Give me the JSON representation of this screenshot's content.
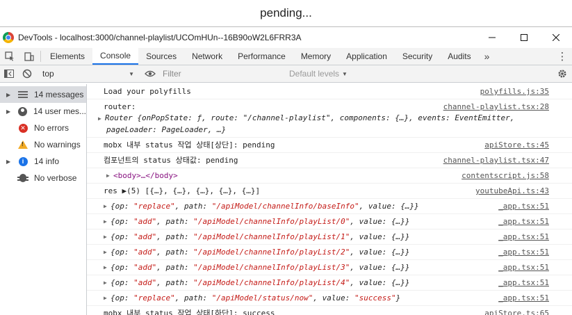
{
  "page": {
    "status_text": "pending..."
  },
  "window": {
    "title": "DevTools - localhost:3000/channel-playlist/UCOmHUn--16B90oW2L6FRR3A",
    "controls": [
      "minimize",
      "maximize",
      "close"
    ]
  },
  "tabs": [
    "Elements",
    "Console",
    "Sources",
    "Network",
    "Performance",
    "Memory",
    "Application",
    "Security",
    "Audits"
  ],
  "active_tab": "Console",
  "toolbar": {
    "context": "top",
    "filter_placeholder": "Filter",
    "levels_label": "Default levels"
  },
  "sidebar": {
    "items": [
      {
        "label": "14 messages",
        "icon": "list-icon",
        "selected": true
      },
      {
        "label": "14 user mes...",
        "icon": "user-icon"
      },
      {
        "label": "No errors",
        "icon": "error-icon"
      },
      {
        "label": "No warnings",
        "icon": "warning-icon"
      },
      {
        "label": "14 info",
        "icon": "info-icon"
      },
      {
        "label": "No verbose",
        "icon": "bug-icon"
      }
    ]
  },
  "messages": [
    {
      "text": "Load your polyfills",
      "source": "polyfills.js:35"
    },
    {
      "text": "router:",
      "source": "channel-playlist.tsx:28",
      "detail": "Router {onPopState: ƒ, route: \"/channel-playlist\", components: {…}, events: EventEmitter, pageLoader: PageLoader, …}"
    },
    {
      "text": "mobx 내부 status 작업 상태[상단]: pending",
      "source": "apiStore.ts:45"
    },
    {
      "text": "컴포넌트의 status 상태값: pending",
      "source": "channel-playlist.tsx:47"
    },
    {
      "text": "<body>…</body>",
      "source": "contentscript.js:58"
    },
    {
      "text": "res ▶(5) [{…}, {…}, {…}, {…}, {…}]",
      "source": "youtubeApi.ts:43"
    },
    {
      "text": "{op: \"replace\", path: \"/apiModel/channelInfo/baseInfo\", value: {…}}",
      "source": "_app.tsx:51"
    },
    {
      "text": "{op: \"add\", path: \"/apiModel/channelInfo/playList/0\", value: {…}}",
      "source": "_app.tsx:51"
    },
    {
      "text": "{op: \"add\", path: \"/apiModel/channelInfo/playList/1\", value: {…}}",
      "source": "_app.tsx:51"
    },
    {
      "text": "{op: \"add\", path: \"/apiModel/channelInfo/playList/2\", value: {…}}",
      "source": "_app.tsx:51"
    },
    {
      "text": "{op: \"add\", path: \"/apiModel/channelInfo/playList/3\", value: {…}}",
      "source": "_app.tsx:51"
    },
    {
      "text": "{op: \"add\", path: \"/apiModel/channelInfo/playList/4\", value: {…}}",
      "source": "_app.tsx:51"
    },
    {
      "text": "{op: \"replace\", path: \"/apiModel/status/now\", value: \"success\"}",
      "source": "_app.tsx:51"
    },
    {
      "text": "mobx 내부 status 작업 상태[하단]: success",
      "source": "apiStore.ts:65"
    }
  ],
  "colors": {
    "accent": "#1a73e8",
    "string": "#c41a16",
    "tag": "#881280"
  }
}
